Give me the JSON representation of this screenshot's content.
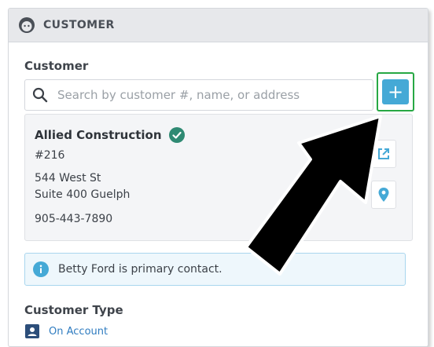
{
  "panel": {
    "header_title": "CUSTOMER"
  },
  "customer_section": {
    "label": "Customer",
    "search_placeholder": "Search by customer #, name, or address",
    "add_label": "+"
  },
  "customer_card": {
    "name": "Allied Construction",
    "number": "#216",
    "address_line1": "544 West St",
    "address_line2": "Suite 400 Guelph",
    "phone": "905-443-7890"
  },
  "info_banner": {
    "text": "Betty Ford is primary contact."
  },
  "customer_type": {
    "label": "Customer Type",
    "value": "On Account"
  },
  "colors": {
    "accent_blue": "#45a9d6",
    "verified_green": "#2f8a73",
    "highlight_green": "#27a844",
    "link_blue": "#2f7cc0"
  }
}
